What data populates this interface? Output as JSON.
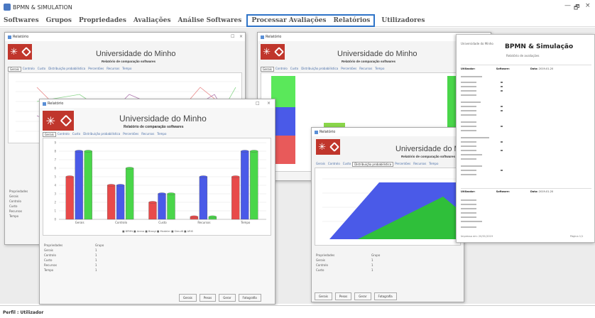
{
  "app": {
    "title": "BPMN & SIMULATION",
    "min": "—",
    "max": "🗗",
    "close": "×"
  },
  "menu": {
    "items": [
      "Softwares",
      "Grupos",
      "Propriedades",
      "Avaliações",
      "Análise Softwares"
    ],
    "highlighted": [
      "Processar Avaliações",
      "Relatórios"
    ],
    "last": "Utilizadores"
  },
  "status": {
    "profile": "Perfil : Utilizador"
  },
  "report": {
    "window_title": "Relatório",
    "university": "Universidade do Minho",
    "subtitle": "Relatório de comparação softwares",
    "tabs": [
      "Gerais",
      "Controlo",
      "Custo",
      "Distribuição probabilística",
      "Percentões",
      "Recursos",
      "Tempo"
    ],
    "buttons": [
      "Gerais",
      "Pesos",
      "Gerar",
      "Fotografia"
    ]
  },
  "front_window": {
    "prop_header": "Propriedades",
    "value_header": "Grupo",
    "props": [
      {
        "label": "Gerais",
        "value": "1"
      },
      {
        "label": "Controlo",
        "value": "1"
      },
      {
        "label": "Custo",
        "value": "1"
      },
      {
        "label": "Recursos",
        "value": "1"
      },
      {
        "label": "Tempo",
        "value": "1"
      }
    ],
    "legend": "■ BPMN ■ Arena ■ Bizagi ■ Modeler ■ Simul8 ■ ARIS"
  },
  "left_window": {
    "props": [
      "Propriedades",
      "Gerais",
      "Controlo",
      "Custo",
      "Recursos",
      "Tempo"
    ]
  },
  "right_window": {
    "props": [
      {
        "label": "Propriedades",
        "value": "Grupo"
      },
      {
        "label": "Gerais",
        "value": "1"
      },
      {
        "label": "Controlo",
        "value": "1"
      },
      {
        "label": "Custo",
        "value": "1"
      }
    ]
  },
  "doc": {
    "title": "BPMN & Simulação",
    "subtitle": "Relatório de avaliações",
    "logo_text": "Universidade do Minho",
    "block1": {
      "user_label": "Utilizador:",
      "software_label": "Software:",
      "date_label": "Data:",
      "date_value": "2019-01-20"
    },
    "block2": {
      "user_label": "Utilizador:",
      "software_label": "Software:",
      "date_label": "Data:",
      "date_value": "2019-01-20"
    },
    "footer_left": "Impresso em: 20/01/2019",
    "footer_right": "Página 1/1"
  },
  "chart_data": {
    "type": "bar",
    "title": "",
    "xlabel": "",
    "ylabel": "",
    "categories": [
      "Gerais",
      "Controlo",
      "Custo",
      "Recursos",
      "Tempo"
    ],
    "ylim": [
      0,
      9
    ],
    "series": [
      {
        "name": "BPMN",
        "color": "#e84a4a",
        "values": [
          5,
          4,
          2,
          0.3,
          5
        ]
      },
      {
        "name": "Bizagi",
        "color": "#4a5ae8",
        "values": [
          8,
          4,
          3,
          5,
          8
        ]
      },
      {
        "name": "Modeler",
        "color": "#4ad64a",
        "values": [
          8,
          6,
          3,
          0.3,
          8
        ]
      }
    ]
  }
}
